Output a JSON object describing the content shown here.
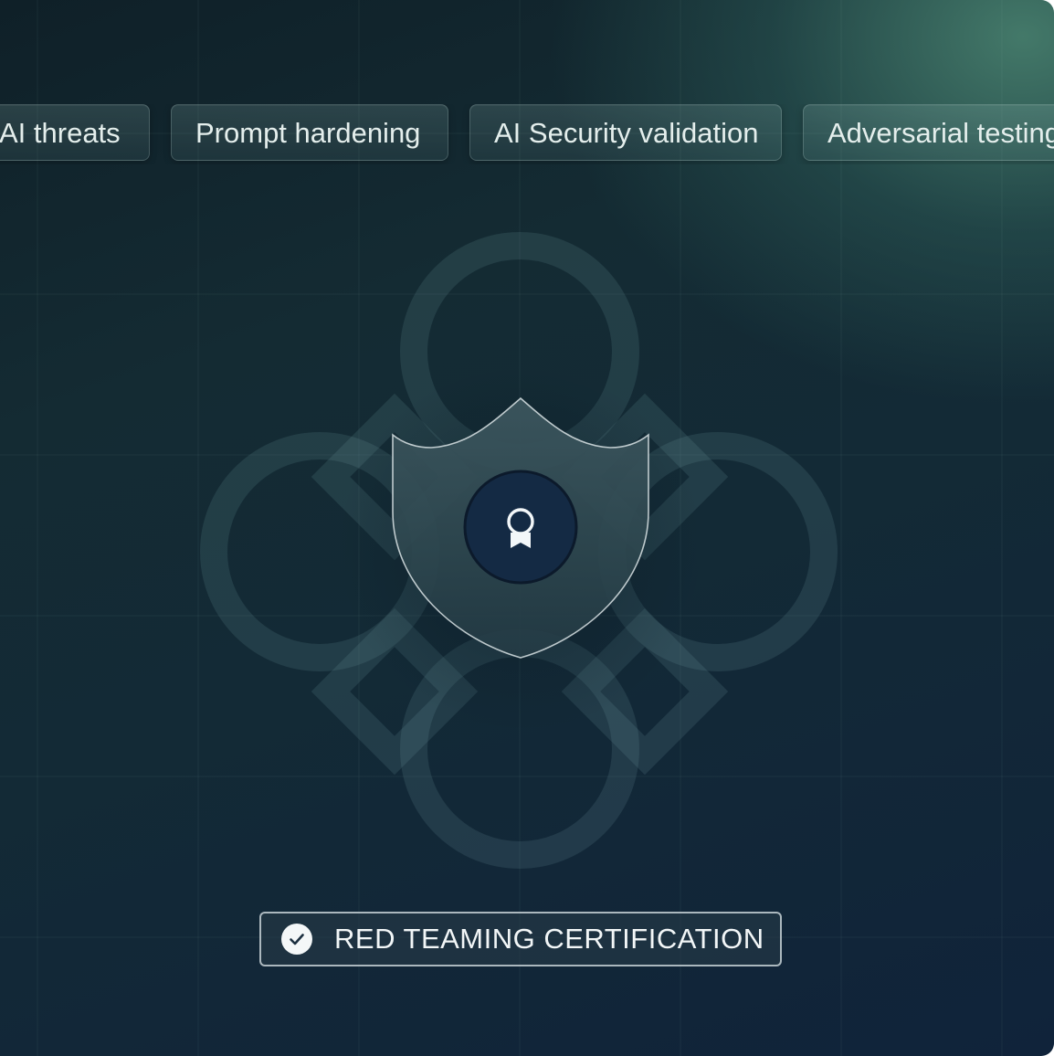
{
  "tags": [
    {
      "label": "AI threats"
    },
    {
      "label": "Prompt hardening"
    },
    {
      "label": "AI Security validation"
    },
    {
      "label": "Adversarial testing"
    }
  ],
  "certification": {
    "label": "RED TEAMING CERTIFICATION",
    "icon": "check-circle-icon"
  },
  "emblem": {
    "shield_icon": "shield-icon",
    "center_icon": "award-ribbon-icon"
  },
  "colors": {
    "background_dark": "#10233a",
    "background_glow": "#467d6c",
    "badge_center": "#142a44",
    "text": "#f2f6f7"
  }
}
